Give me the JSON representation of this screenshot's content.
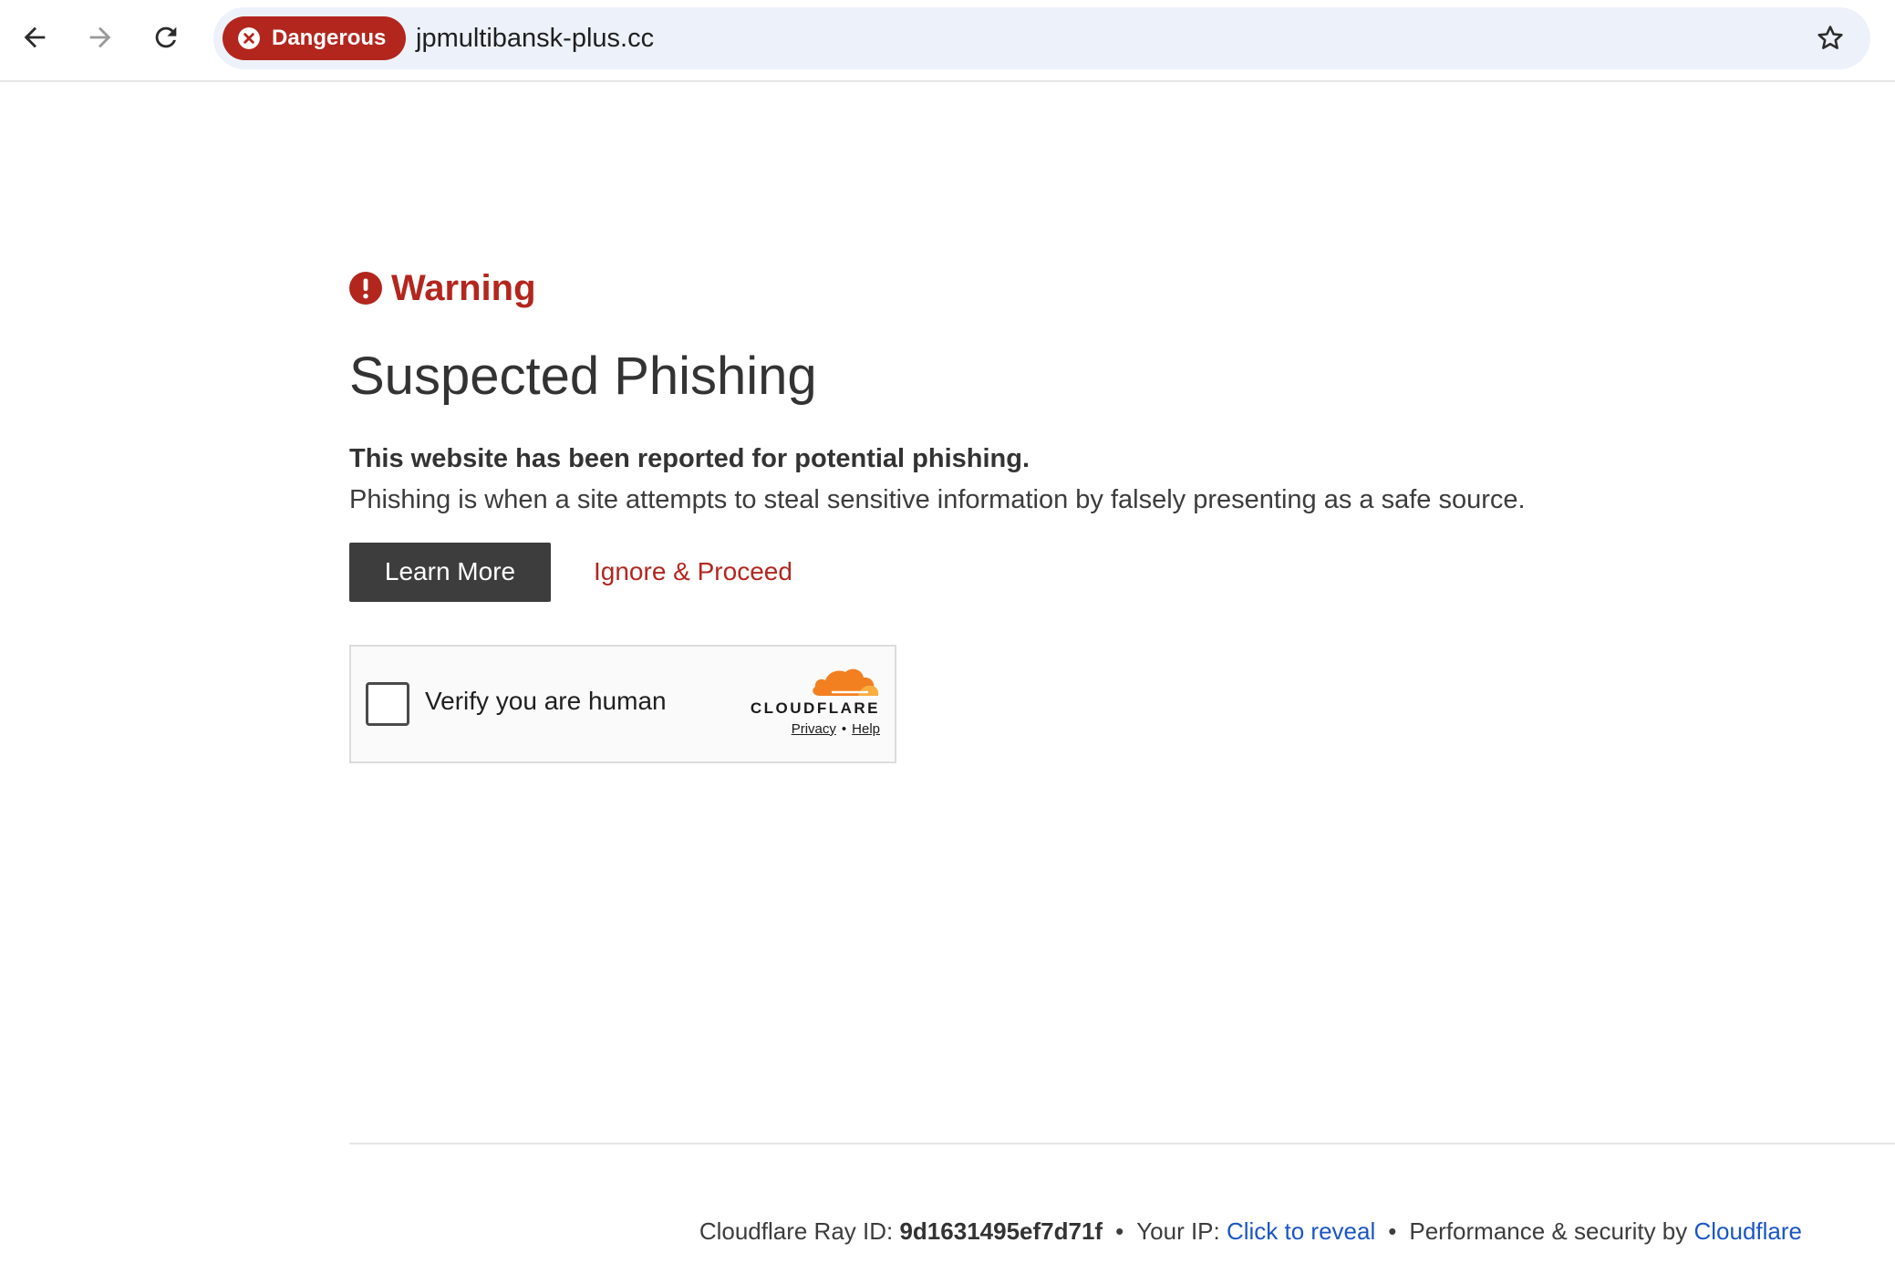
{
  "browser": {
    "security_chip": "Dangerous",
    "url": "jpmultibansk-plus.cc",
    "icons": {
      "back": "arrow-left-icon",
      "forward": "arrow-right-icon",
      "reload": "reload-icon",
      "bookmark": "star-outline-icon",
      "danger": "x-circle-icon"
    }
  },
  "warning": {
    "label": "Warning",
    "title": "Suspected Phishing",
    "lead": "This website has been reported for potential phishing.",
    "description": "Phishing is when a site attempts to steal sensitive information by falsely presenting as a safe source.",
    "learn_more": "Learn More",
    "proceed": "Ignore & Proceed"
  },
  "turnstile": {
    "checkbox_label": "Verify you are human",
    "brand": "CLOUDFLARE",
    "privacy": "Privacy",
    "separator": "•",
    "help": "Help"
  },
  "footer": {
    "ray_label": "Cloudflare Ray ID:",
    "ray_id": "9d1631495ef7d71f",
    "sep": "•",
    "ip_label": "Your IP:",
    "ip_link": "Click to reveal",
    "perf_label": "Performance & security by",
    "cf_link": "Cloudflare"
  },
  "colors": {
    "danger": "#b3261e",
    "omnibox": "#edf2fa",
    "button_dark": "#3d3d3d",
    "link_blue": "#1a56c4",
    "cloudflare_orange": "#f38020"
  }
}
